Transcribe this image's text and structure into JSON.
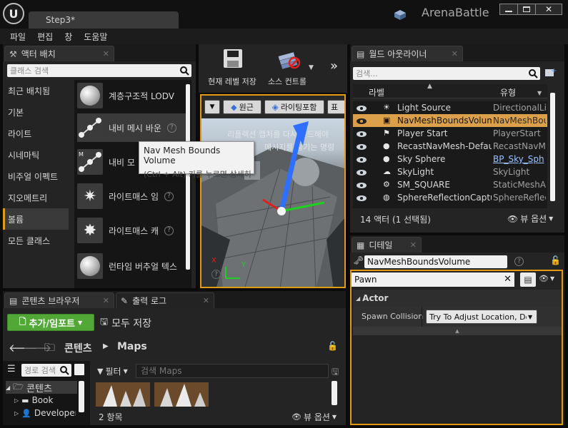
{
  "window": {
    "tab_title": "Step3*",
    "app_name": "ArenaBattle"
  },
  "menu": [
    "파일",
    "편집",
    "창",
    "도움말"
  ],
  "place_actors": {
    "tab_label": "액터 배치",
    "search_placeholder": "클래스 검색",
    "categories": [
      "최근 배치됨",
      "기본",
      "라이트",
      "시네마틱",
      "비주얼 이펙트",
      "지오메트리",
      "볼륨",
      "모든 클래스"
    ],
    "active_category": "볼륨",
    "assets": [
      "계층구조적 LODV",
      "내비 메시 바운",
      "내비 모",
      "라이트매스 임",
      "라이트매스 캐",
      "런타임 버추얼 텍스"
    ]
  },
  "tooltip": {
    "title": "Nav Mesh Bounds Volume",
    "hint": "(Ctrl + Alt) 키를 누르면 상세히"
  },
  "toolbar": {
    "save_label": "현재 레벨 저장",
    "source_label": "소스 컨트롤"
  },
  "viewport": {
    "perspective_label": "원근",
    "lighting_label": "라이팅포함",
    "show_label": "표",
    "message1": "리플렉션 캡처를 다시 빌드해야",
    "message2": "메시지를 숨기는 명령",
    "axis_x": "X",
    "axis_y": "Y"
  },
  "outliner": {
    "tab_label": "월드 아웃라이너",
    "search_placeholder": "검색...",
    "col_label": "라벨",
    "col_type": "유형",
    "rows": [
      {
        "name": "Light Source",
        "type": "DirectionalLig",
        "icon": "sun-icon"
      },
      {
        "name": "NavMeshBoundsVolume",
        "type": "NavMeshBou",
        "icon": "cube-icon",
        "selected": true
      },
      {
        "name": "Player Start",
        "type": "PlayerStart",
        "icon": "flag-icon"
      },
      {
        "name": "RecastNavMesh-Default",
        "type": "RecastNavMe",
        "icon": "sphere-icon"
      },
      {
        "name": "Sky Sphere",
        "type": "BP_Sky_Sph",
        "icon": "sphere-icon",
        "link": true
      },
      {
        "name": "SkyLight",
        "type": "SkyLight",
        "icon": "skylight-icon"
      },
      {
        "name": "SM_SQUARE",
        "type": "StaticMeshAc",
        "icon": "mesh-icon"
      },
      {
        "name": "SphereReflectionCapture",
        "type": "SphereReflect",
        "icon": "reflection-icon"
      }
    ],
    "count": "14 액터 (1 선택됨)",
    "view_options": "뷰 옵션"
  },
  "details": {
    "tab_label": "디테일",
    "name_value": "NavMeshBoundsVolume",
    "search_value": "Pawn",
    "section": "Actor",
    "property_label": "Spawn Collision",
    "property_value": "Try To Adjust Location, Don"
  },
  "content_browser": {
    "tab_label": "콘텐츠 브라우저",
    "output_tab_label": "출력 로그",
    "add_import": "추가/임포트",
    "save_all": "모두 저장",
    "path_root": "콘텐츠",
    "path_leaf": "Maps",
    "path_search_placeholder": "경로 검색",
    "filter_label": "필터",
    "asset_search_placeholder": "검색 Maps",
    "tree": [
      "콘텐츠",
      "Book",
      "Developer"
    ],
    "count": "2 항목",
    "view_options": "뷰 옵션"
  },
  "colors": {
    "accent": "#e09a16",
    "selection": "#dca04a",
    "green": "#51a836",
    "link": "#9bc3ff"
  }
}
